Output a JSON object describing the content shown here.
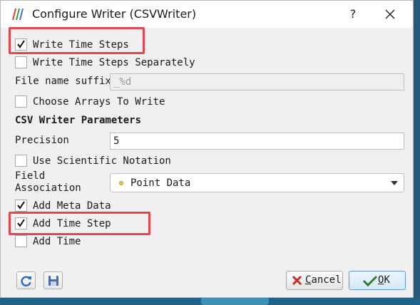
{
  "window": {
    "title": "Configure Writer (CSVWriter)",
    "help_label": "?"
  },
  "options": {
    "write_time_steps": {
      "label": "Write Time Steps",
      "checked": true
    },
    "write_time_steps_separately": {
      "label": "Write Time Steps Separately",
      "checked": false
    },
    "file_name_suffix": {
      "label": "File name suffix",
      "value": "_%d"
    },
    "choose_arrays": {
      "label": "Choose Arrays To Write",
      "checked": false
    }
  },
  "csv_params": {
    "section_title": "CSV Writer Parameters",
    "precision": {
      "label": "Precision",
      "value": "5"
    },
    "scientific": {
      "label": "Use Scientific Notation",
      "checked": false
    },
    "field_association": {
      "label_line1": "Field",
      "label_line2": "Association",
      "value": "Point Data"
    },
    "add_meta_data": {
      "label": "Add Meta Data",
      "checked": true
    },
    "add_time_step": {
      "label": "Add Time Step",
      "checked": true
    },
    "add_time": {
      "label": "Add Time",
      "checked": false
    }
  },
  "buttons": {
    "cancel_mnemonic": "C",
    "cancel_rest": "ancel",
    "ok_mnemonic": "O",
    "ok_rest": "K"
  },
  "colors": {
    "highlight": "#e5454d",
    "accent": "#5f96d3"
  }
}
